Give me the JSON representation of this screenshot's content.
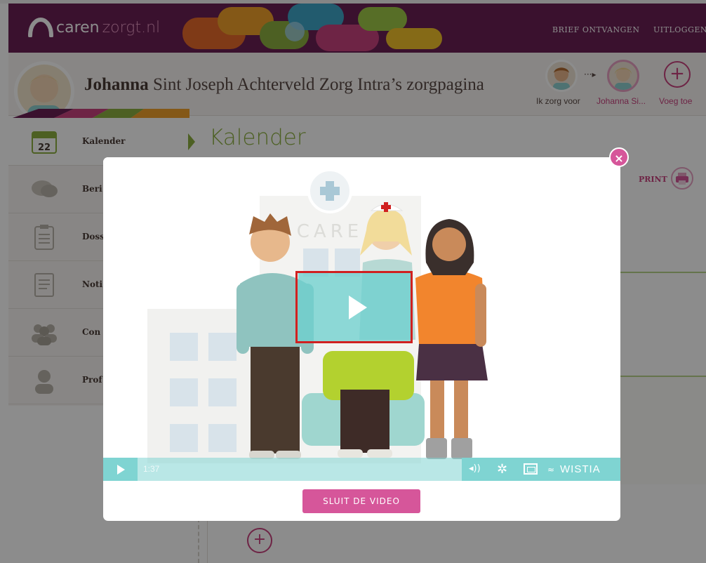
{
  "brand": {
    "name": "caren",
    "suffix": "zorgt.nl"
  },
  "header_nav": {
    "receive_letter": "BRIEF ONTVANGEN",
    "logout": "UITLOGGEN"
  },
  "profile": {
    "first_name": "Johanna",
    "rest": " Sint Joseph Achterveld Zorg Intra’s zorgpagina"
  },
  "switcher": {
    "self_label": "Ik zorg voor",
    "arrow_icon": "arrow-right-icon",
    "current_label": "Johanna Si...",
    "add_symbol": "+",
    "add_label": "Voeg toe"
  },
  "sidebar": {
    "items": [
      {
        "label": "Kalender",
        "icon": "calendar-icon",
        "day": "22",
        "active": true
      },
      {
        "label": "Beri",
        "icon": "chat-bubbles-icon"
      },
      {
        "label": "Doss",
        "icon": "clipboard-icon"
      },
      {
        "label": "Noti",
        "icon": "notes-icon"
      },
      {
        "label": "Con",
        "icon": "people-icon"
      },
      {
        "label": "Prof",
        "icon": "person-icon"
      }
    ]
  },
  "main": {
    "title": "Kalender",
    "print_label": "PRINT",
    "print_icon": "printer-icon",
    "add_symbol": "+"
  },
  "modal": {
    "close_symbol": "×",
    "video": {
      "sign": "CARE",
      "time": "1:37",
      "brand": "WISTIA",
      "play_icon": "play-icon",
      "volume_symbol": "◂))",
      "settings_symbol": "✲"
    },
    "close_button": "SLUIT DE VIDEO"
  },
  "colors": {
    "header": "#6b1f55",
    "accent_pink": "#d6569a",
    "accent_green": "#8cb040",
    "player_teal": "#7fd4d2",
    "highlight_red": "#d02020"
  }
}
